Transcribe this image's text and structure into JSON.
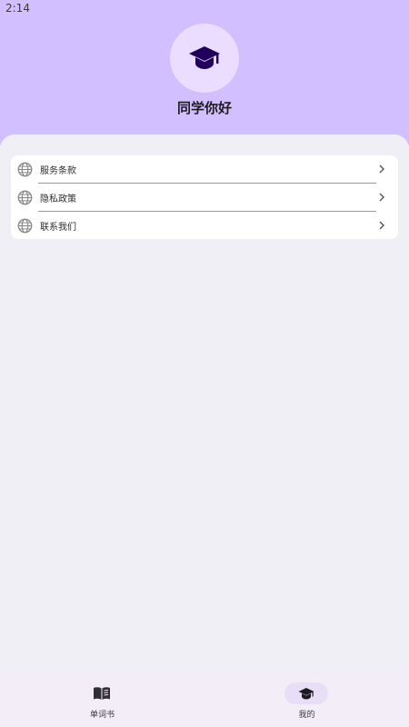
{
  "status_bar": {
    "time": "2:14"
  },
  "profile": {
    "greeting": "同学你好",
    "avatar_icon": "graduation-cap-icon"
  },
  "menu": {
    "items": [
      {
        "label": "服务条款",
        "icon": "globe-icon"
      },
      {
        "label": "隐私政策",
        "icon": "globe-icon"
      },
      {
        "label": "联系我们",
        "icon": "globe-icon"
      }
    ]
  },
  "bottom_nav": {
    "items": [
      {
        "label": "单词书",
        "icon": "book-icon",
        "active": false
      },
      {
        "label": "我的",
        "icon": "graduation-cap-icon",
        "active": true
      }
    ]
  },
  "colors": {
    "header_bg": "#d2bfff",
    "avatar_bg": "#eaddff",
    "icon_dark": "#21005d",
    "page_bg": "#f0eff5",
    "nav_bg": "#f3edf8",
    "active_pill": "#e8def8"
  }
}
